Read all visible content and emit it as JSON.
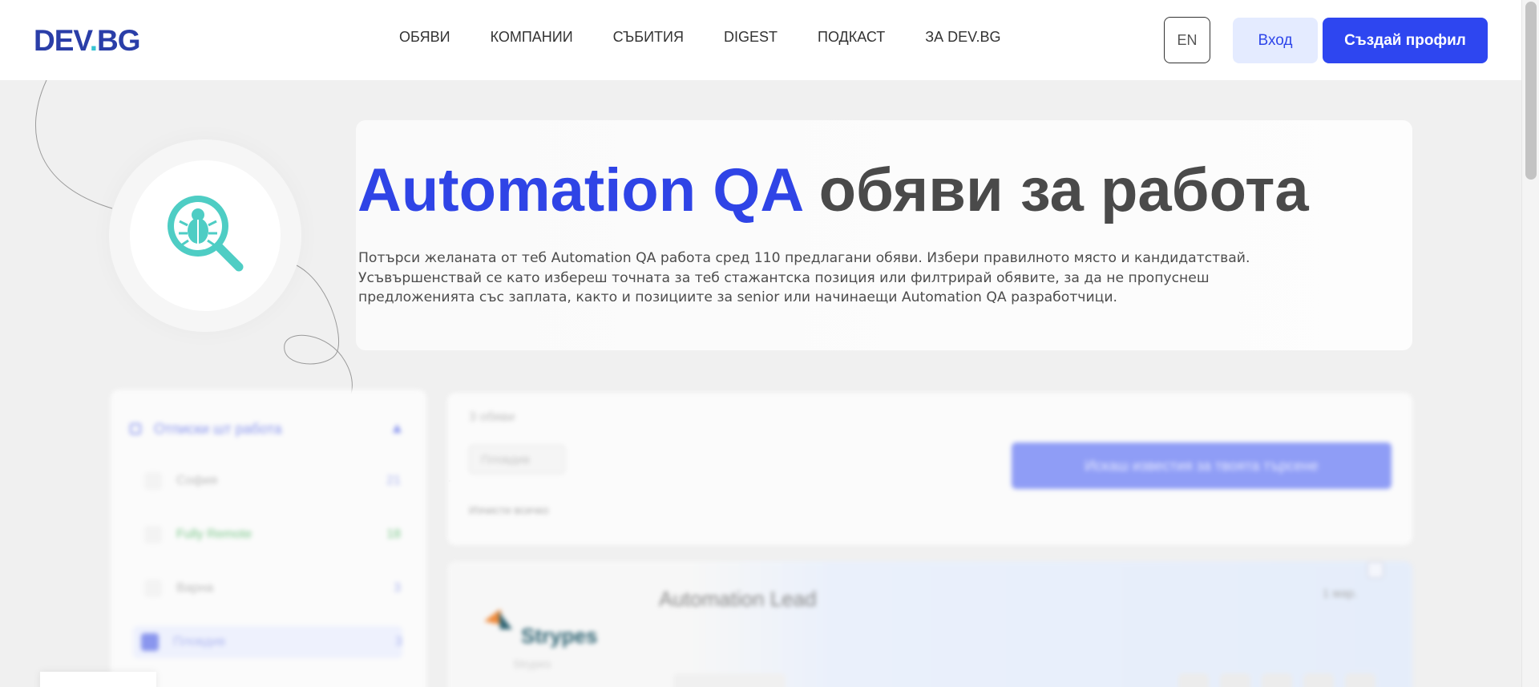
{
  "header": {
    "logo_text": "DEV",
    "logo_dot": ".",
    "logo_suffix": "BG",
    "nav": [
      "ОБЯВИ",
      "КОМПАНИИ",
      "СЪБИТИЯ",
      "DIGEST",
      "ПОДКАСТ",
      "ЗА DEV.BG"
    ],
    "lang_label": "EN",
    "login_label": "Вход",
    "signup_label": "Създай профил"
  },
  "hero": {
    "title_highlight": "Automation QA",
    "title_rest": " обяви за работа",
    "description": "Потърси желаната от теб Automation QA работа сред 110 предлагани обяви. Избери правилното място и кандидатствай. Усъвършенствай се като избереш точната за теб стажантска позиция или филтрирай обявите, за да не пропуснеш предложенията със заплата, както и позициите за senior или начинаещи Automation QA разработчици.",
    "icon": "bug-search-icon"
  },
  "filters": {
    "title": "Отписки шт работа",
    "items": [
      {
        "label": "София",
        "count": "21"
      },
      {
        "label": "Fully Remote",
        "count": "18"
      },
      {
        "label": "Варна",
        "count": "3"
      },
      {
        "label": "Пловдив",
        "count": "3"
      }
    ]
  },
  "results": {
    "count_text": "3 обяви",
    "chip_label": "Пловдив",
    "clear_label": "Изчисти всичко",
    "notify_label": "Искаш известия за твоята търсене"
  },
  "job": {
    "title": "Automation Lead",
    "date": "1 мар.",
    "company": "Strypes",
    "company_sub": "Strypes"
  },
  "colors": {
    "primary": "#2e46f0",
    "logo": "#2a3ea8",
    "accent": "#36c3d2",
    "icon_teal": "#4ecdc4"
  }
}
